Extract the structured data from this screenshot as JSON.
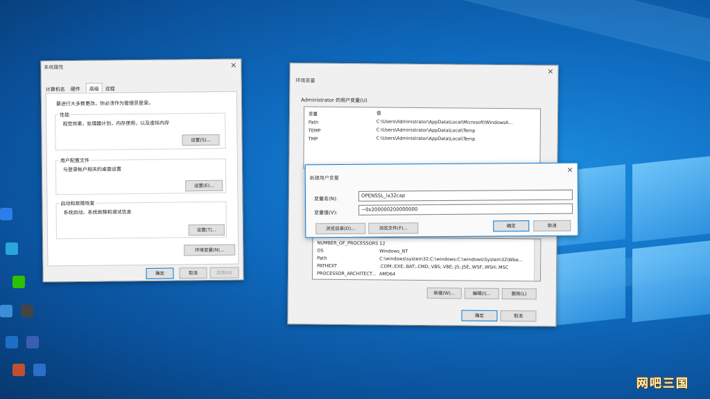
{
  "sys_props": {
    "title": "系统属性",
    "tabs": [
      "计算机名",
      "硬件",
      "高级",
      "远程"
    ],
    "admin_note": "要进行大多数更改，你必须作为管理员登录。",
    "perf_heading": "性能",
    "perf_desc": "视觉效果，处理器计划，内存使用，以及虚拟内存",
    "perf_button": "设置(S)...",
    "profile_heading": "用户配置文件",
    "profile_desc": "与登录帐户相关的桌面设置",
    "profile_button": "设置(E)...",
    "startup_heading": "启动和故障恢复",
    "startup_desc": "系统启动、系统故障和调试信息",
    "startup_button": "设置(T)...",
    "env_button": "环境变量(N)...",
    "ok": "确定",
    "cancel": "取消",
    "apply": "应用(A)"
  },
  "env_vars": {
    "title": "环境变量",
    "user_group": "Administrator 的用户变量(U)",
    "col_var": "变量",
    "col_val": "值",
    "user_rows": [
      {
        "name": "Path",
        "value": "C:\\Users\\Administrator\\AppData\\Local\\Microsoft\\WindowsA..."
      },
      {
        "name": "TEMP",
        "value": "C:\\Users\\Administrator\\AppData\\Local\\Temp"
      },
      {
        "name": "TMP",
        "value": "C:\\Users\\Administrator\\AppData\\Local\\Temp"
      }
    ],
    "sys_rows": [
      {
        "name": "NUMBER_OF_PROCESSORS",
        "value": "12"
      },
      {
        "name": "OS",
        "value": "Windows_NT"
      },
      {
        "name": "Path",
        "value": "C:\\windows\\system32;C:\\windows;C:\\windows\\System32\\Wbe..."
      },
      {
        "name": "PATHEXT",
        "value": ".COM;.EXE;.BAT;.CMD;.VBS;.VBE;.JS;.JSE;.WSF;.WSH;.MSC"
      },
      {
        "name": "PROCESSOR_ARCHITECT...",
        "value": "AMD64"
      }
    ],
    "new_button": "新建(W)...",
    "edit_button": "编辑(I)...",
    "delete_button": "删除(L)",
    "ok": "确定",
    "cancel": "取消"
  },
  "new_var": {
    "title": "新建用户变量",
    "name_label": "变量名(N):",
    "name_value": "OPENSSL_ia32cap",
    "value_label": "变量值(V):",
    "value_value": "~0x200000200000000",
    "browse_dir": "浏览目录(D)...",
    "browse_file": "浏览文件(F)...",
    "ok": "确定",
    "cancel": "取消"
  },
  "watermark": "网吧三国"
}
